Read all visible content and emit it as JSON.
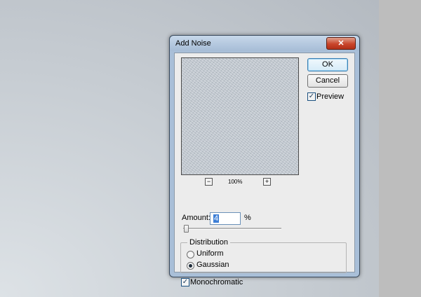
{
  "dialog": {
    "title": "Add Noise",
    "close_glyph": "✕",
    "ok_label": "OK",
    "cancel_label": "Cancel",
    "preview_label": "Preview",
    "preview_checked": true,
    "zoom": {
      "minus": "−",
      "plus": "+",
      "level": "100%"
    },
    "amount": {
      "label": "Amount:",
      "value": "4",
      "unit": "%"
    },
    "distribution": {
      "title": "Distribution",
      "options": [
        {
          "label": "Uniform",
          "selected": false
        },
        {
          "label": "Gaussian",
          "selected": true
        }
      ]
    },
    "monochromatic": {
      "label": "Monochromatic",
      "checked": true
    },
    "check_glyph": "✓"
  }
}
